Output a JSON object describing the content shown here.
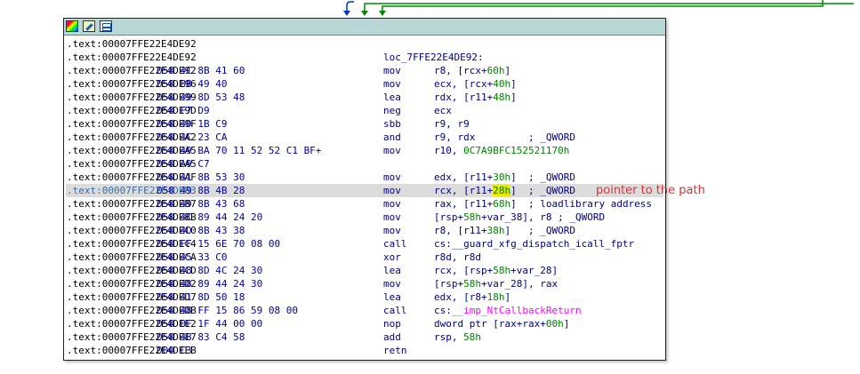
{
  "toolbar": {
    "icons": [
      "palette-icon",
      "edit-icon",
      "graph-icon"
    ]
  },
  "lines": [
    {
      "address": ".text:00007FFE22E4DE92",
      "bytes": "",
      "label": "",
      "mnemonic": "",
      "operands": [],
      "highlight": false
    },
    {
      "address": ".text:00007FFE22E4DE92",
      "bytes": "",
      "label": "loc_7FFE22E4DE92:",
      "mnemonic": "",
      "operands": [],
      "highlight": false
    },
    {
      "address": ".text:00007FFE22E4DE92",
      "bytes": "058 4C 8B 41 60",
      "label": "",
      "mnemonic": "mov",
      "operands": [
        {
          "t": "r8, [rcx+"
        },
        {
          "t": "60h",
          "c": "num"
        },
        {
          "t": "]"
        }
      ],
      "highlight": false
    },
    {
      "address": ".text:00007FFE22E4DE96",
      "bytes": "058 8B 49 40",
      "label": "",
      "mnemonic": "mov",
      "operands": [
        {
          "t": "ecx, [rcx+"
        },
        {
          "t": "40h",
          "c": "num"
        },
        {
          "t": "]"
        }
      ],
      "highlight": false
    },
    {
      "address": ".text:00007FFE22E4DE99",
      "bytes": "058 49 8D 53 48",
      "label": "",
      "mnemonic": "lea",
      "operands": [
        {
          "t": "rdx, [r11+"
        },
        {
          "t": "48h",
          "c": "num"
        },
        {
          "t": "]"
        }
      ],
      "highlight": false
    },
    {
      "address": ".text:00007FFE22E4DE9D",
      "bytes": "058 F7 D9",
      "label": "",
      "mnemonic": "neg",
      "operands": [
        {
          "t": "ecx"
        }
      ],
      "highlight": false
    },
    {
      "address": ".text:00007FFE22E4DE9F",
      "bytes": "058 4D 1B C9",
      "label": "",
      "mnemonic": "sbb",
      "operands": [
        {
          "t": "r9, r9"
        }
      ],
      "highlight": false
    },
    {
      "address": ".text:00007FFE22E4DEA2",
      "bytes": "058 4C 23 CA",
      "label": "",
      "mnemonic": "and",
      "operands": [
        {
          "t": "r9, rdx         ; _QWORD"
        }
      ],
      "highlight": false
    },
    {
      "address": ".text:00007FFE22E4DEA5",
      "bytes": "058 49 BA 70 11 52 52 C1 BF+",
      "label": "",
      "mnemonic": "mov",
      "operands": [
        {
          "t": "r10, "
        },
        {
          "t": "0C7A9BFC152521170h",
          "c": "num"
        }
      ],
      "highlight": false
    },
    {
      "address": ".text:00007FFE22E4DEA5",
      "bytes": "058 A9 C7",
      "label": "",
      "mnemonic": "",
      "operands": [],
      "highlight": false
    },
    {
      "address": ".text:00007FFE22E4DEAF",
      "bytes": "058 41 8B 53 30",
      "label": "",
      "mnemonic": "mov",
      "operands": [
        {
          "t": "edx, [r11+"
        },
        {
          "t": "30h",
          "c": "num"
        },
        {
          "t": "]  ; _QWORD"
        }
      ],
      "highlight": false
    },
    {
      "address": ".text:00007FFE22E4DEB3",
      "bytes": "058 49 8B 4B 28",
      "label": "",
      "mnemonic": "mov",
      "operands": [
        {
          "t": "rcx, [r11+"
        },
        {
          "t": "28h",
          "c": "num mark"
        },
        {
          "t": "]  ; _QWORD"
        }
      ],
      "highlight": true
    },
    {
      "address": ".text:00007FFE22E4DEB7",
      "bytes": "058 49 8B 43 68",
      "label": "",
      "mnemonic": "mov",
      "operands": [
        {
          "t": "rax, [r11+"
        },
        {
          "t": "68h",
          "c": "num"
        },
        {
          "t": "]  ; loadlibrary address"
        }
      ],
      "highlight": false
    },
    {
      "address": ".text:00007FFE22E4DEBB",
      "bytes": "058 4C 89 44 24 20",
      "label": "",
      "mnemonic": "mov",
      "operands": [
        {
          "t": "[rsp+"
        },
        {
          "t": "58h",
          "c": "num"
        },
        {
          "t": "+var_38], r8 ; _QWORD"
        }
      ],
      "highlight": false
    },
    {
      "address": ".text:00007FFE22E4DEC0",
      "bytes": "058 4D 8B 43 38",
      "label": "",
      "mnemonic": "mov",
      "operands": [
        {
          "t": "r8, [r11+"
        },
        {
          "t": "38h",
          "c": "num"
        },
        {
          "t": "]   ; _QWORD"
        }
      ],
      "highlight": false
    },
    {
      "address": ".text:00007FFE22E4DEC4",
      "bytes": "058 FF 15 6E 70 08 00",
      "label": "",
      "mnemonic": "call",
      "operands": [
        {
          "t": "cs:__guard_xfg_dispatch_icall_fptr"
        }
      ],
      "highlight": false
    },
    {
      "address": ".text:00007FFE22E4DECA",
      "bytes": "058 45 33 C0",
      "label": "",
      "mnemonic": "xor",
      "operands": [
        {
          "t": "r8d, r8d"
        }
      ],
      "highlight": false
    },
    {
      "address": ".text:00007FFE22E4DECD",
      "bytes": "058 48 8D 4C 24 30",
      "label": "",
      "mnemonic": "lea",
      "operands": [
        {
          "t": "rcx, [rsp+"
        },
        {
          "t": "58h",
          "c": "num"
        },
        {
          "t": "+var_28]"
        }
      ],
      "highlight": false
    },
    {
      "address": ".text:00007FFE22E4DED2",
      "bytes": "058 48 89 44 24 30",
      "label": "",
      "mnemonic": "mov",
      "operands": [
        {
          "t": "[rsp+"
        },
        {
          "t": "58h",
          "c": "num"
        },
        {
          "t": "+var_28], rax"
        }
      ],
      "highlight": false
    },
    {
      "address": ".text:00007FFE22E4DED7",
      "bytes": "058 41 8D 50 18",
      "label": "",
      "mnemonic": "lea",
      "operands": [
        {
          "t": "edx, [r8+"
        },
        {
          "t": "18h",
          "c": "num"
        },
        {
          "t": "]"
        }
      ],
      "highlight": false
    },
    {
      "address": ".text:00007FFE22E4DEDB",
      "bytes": "058 48 FF 15 86 59 08 00",
      "label": "",
      "mnemonic": "call",
      "operands": [
        {
          "t": "cs:"
        },
        {
          "t": "__imp_NtCallbackReturn",
          "c": "sym"
        }
      ],
      "highlight": false
    },
    {
      "address": ".text:00007FFE22E4DEE2",
      "bytes": "058 0F 1F 44 00 00",
      "label": "",
      "mnemonic": "nop",
      "operands": [
        {
          "t": "dword ptr [rax+rax+"
        },
        {
          "t": "00h",
          "c": "num"
        },
        {
          "t": "]"
        }
      ],
      "highlight": false
    },
    {
      "address": ".text:00007FFE22E4DEE7",
      "bytes": "058 48 83 C4 58",
      "label": "",
      "mnemonic": "add",
      "operands": [
        {
          "t": "rsp, "
        },
        {
          "t": "58h",
          "c": "num"
        }
      ],
      "highlight": false
    },
    {
      "address": ".text:00007FFE22E4DEEB",
      "bytes": "000 C3",
      "label": "",
      "mnemonic": "retn",
      "operands": [],
      "highlight": false
    }
  ],
  "annotation": "pointer to the path",
  "colors": {
    "titlebar": "#b8d8d8",
    "number": "#008000",
    "import": "#ff00ff",
    "annotation": "#e03030",
    "arrow_blue": "#0033cc",
    "arrow_green": "#008800"
  }
}
